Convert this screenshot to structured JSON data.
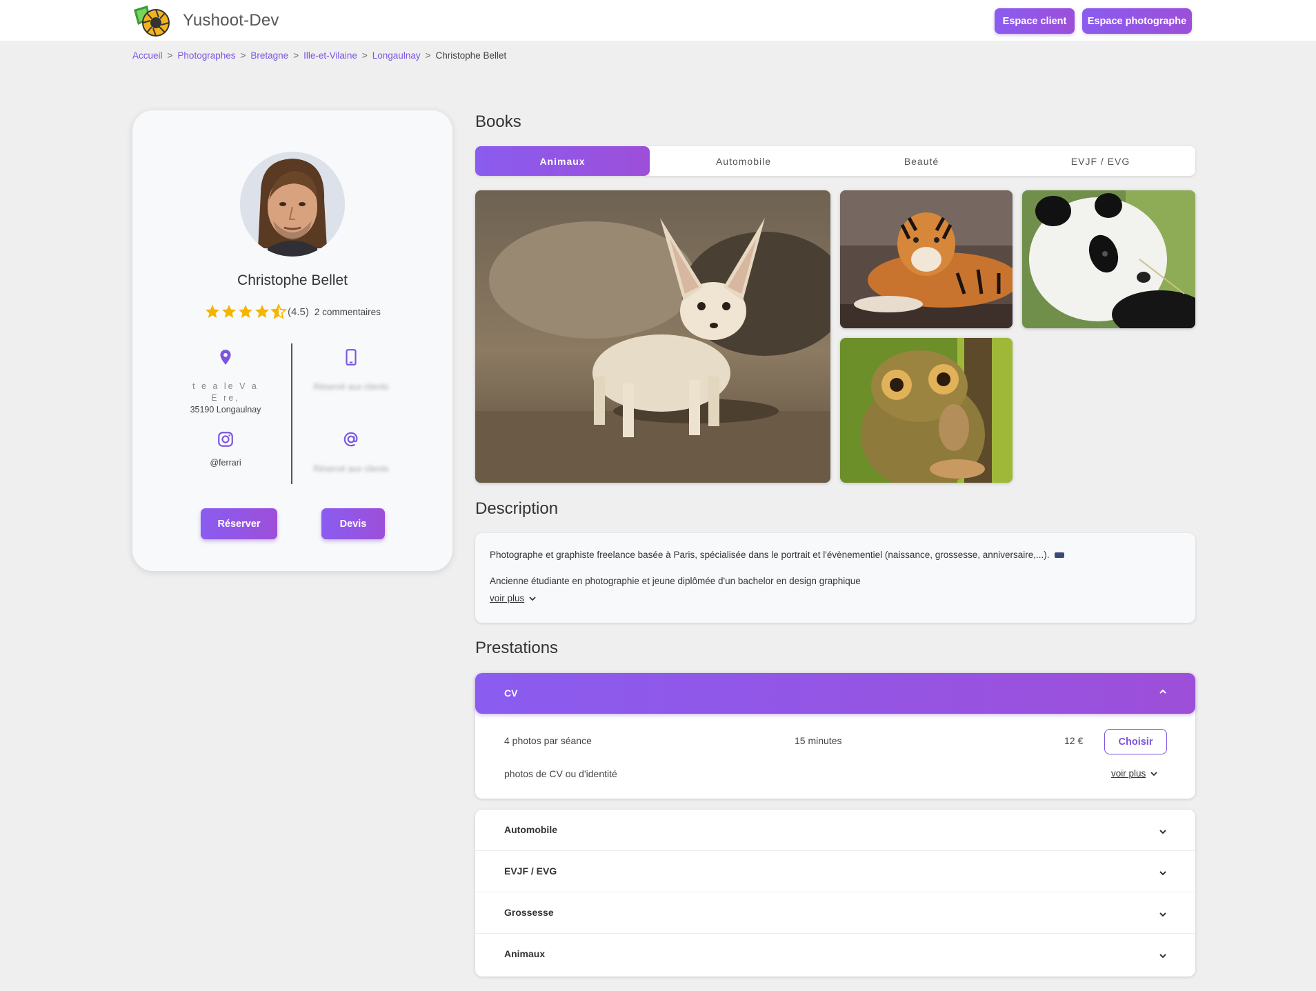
{
  "header": {
    "brand": "Yushoot-Dev",
    "buttons": {
      "client": "Espace client",
      "photographer": "Espace photographe"
    }
  },
  "breadcrumb": {
    "items": [
      "Accueil",
      "Photographes",
      "Bretagne",
      "Ille-et-Vilaine",
      "Longaulnay"
    ],
    "separator": ">",
    "current": "Christophe Bellet"
  },
  "profile": {
    "name": "Christophe Bellet",
    "rating_value": "(4.5)",
    "rating_stars": 4.5,
    "comments": "2 commentaires",
    "address_line1": "t  e  a  le  V     a",
    "address_line2": "E  re,",
    "address_line3": "35190 Longaulnay",
    "phone_hidden": "Réservé aux clients",
    "instagram": "@ferrari",
    "email_hidden": "Réservé aux clients",
    "reserve_label": "Réserver",
    "quote_label": "Devis"
  },
  "books": {
    "title": "Books",
    "tabs": [
      "Animaux",
      "Automobile",
      "Beauté",
      "EVJF / EVG"
    ],
    "active_tab": 0
  },
  "description": {
    "title": "Description",
    "line1": "Photographe et graphiste freelance basée à Paris, spécialisée dans le portrait et l'évènementiel (naissance, grossesse, anniversaire,...).",
    "line2": "Ancienne étudiante en photographie et jeune diplômée d'un bachelor en design graphique",
    "more": "voir plus"
  },
  "prestations": {
    "title": "Prestations",
    "open": {
      "name": "CV",
      "photos": "4 photos par séance",
      "duration": "15 minutes",
      "price": "12 €",
      "choose": "Choisir",
      "detail": "photos de CV ou d'identité",
      "more": "voir plus"
    },
    "collapsed": [
      "Automobile",
      "EVJF / EVG",
      "Grossesse",
      "Animaux"
    ]
  },
  "colors": {
    "accent": "#8a5cf0",
    "accent2": "#9d4fd9",
    "star": "#f5b400",
    "background": "#efefef"
  }
}
